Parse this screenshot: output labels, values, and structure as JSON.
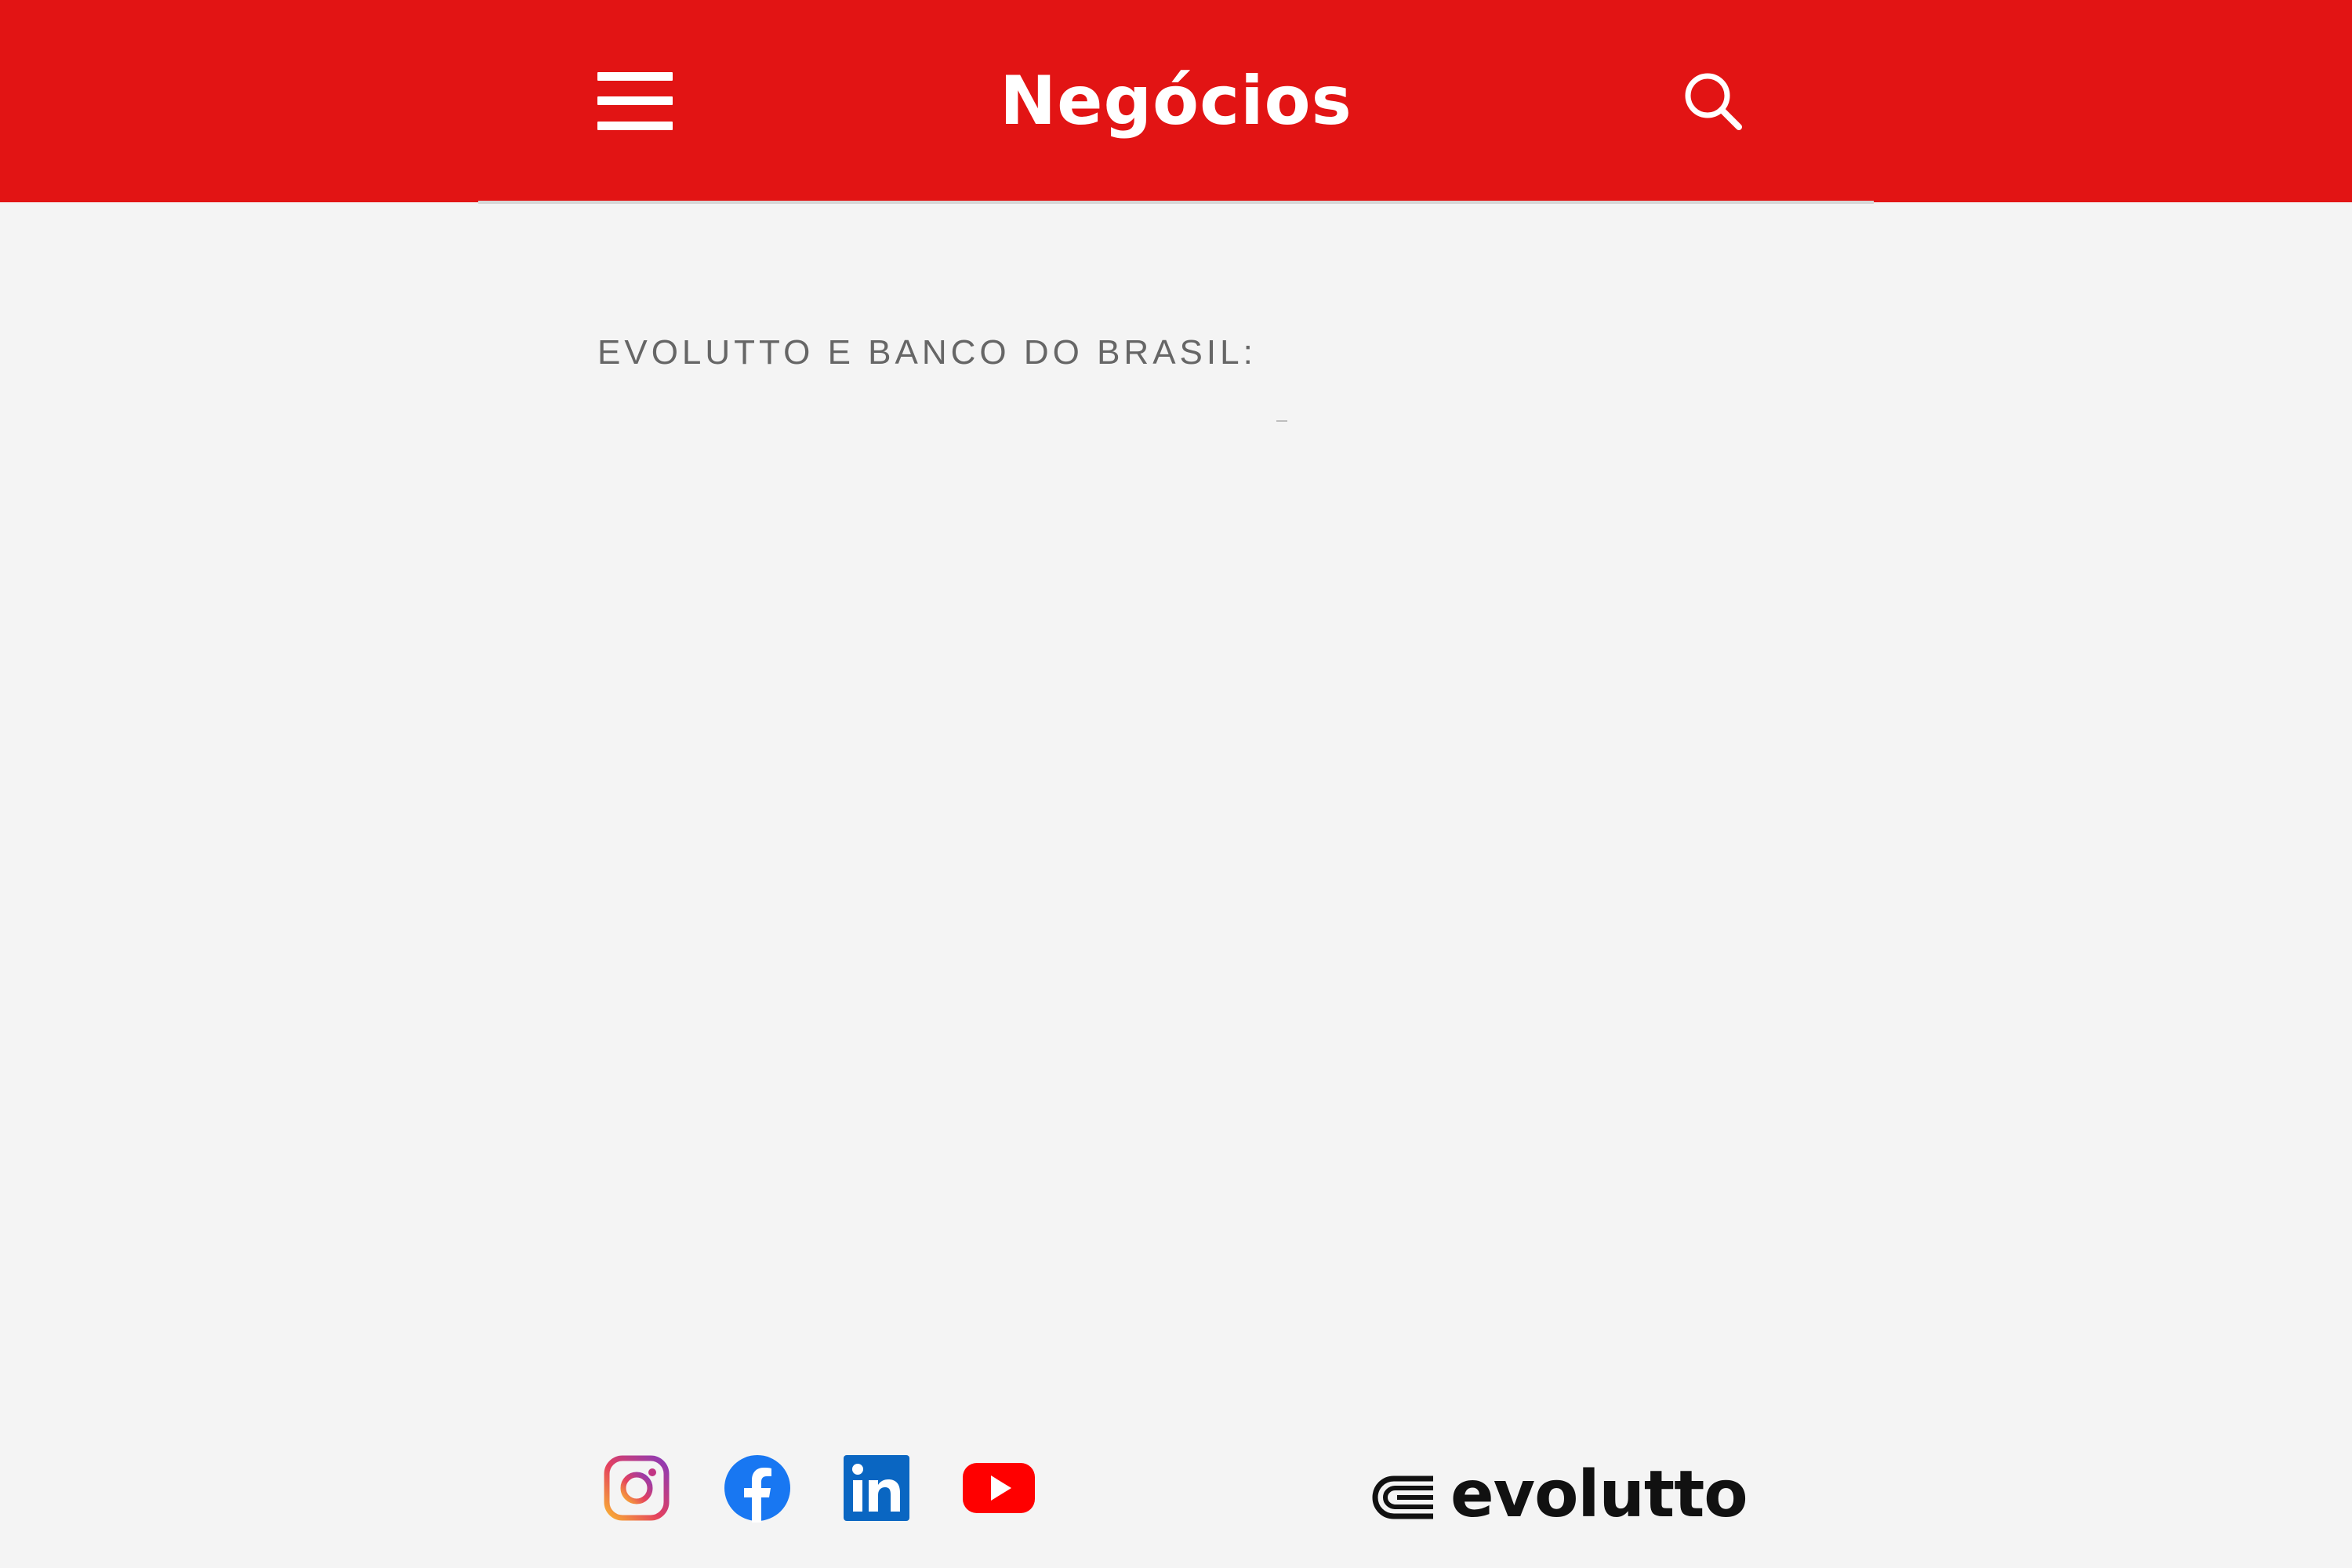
{
  "header": {
    "title": "Negócios",
    "background_color": "#e21414",
    "menu_icon": "hamburger-menu-icon",
    "search_icon": "search-icon"
  },
  "main": {
    "section_heading": "EVOLUTTO E BANCO DO BRASIL:"
  },
  "footer": {
    "social_links": [
      {
        "name": "Instagram",
        "icon": "instagram-icon"
      },
      {
        "name": "Facebook",
        "icon": "facebook-icon"
      },
      {
        "name": "LinkedIn",
        "icon": "linkedin-icon"
      },
      {
        "name": "YouTube",
        "icon": "youtube-icon"
      }
    ],
    "brand": "evolutto"
  }
}
